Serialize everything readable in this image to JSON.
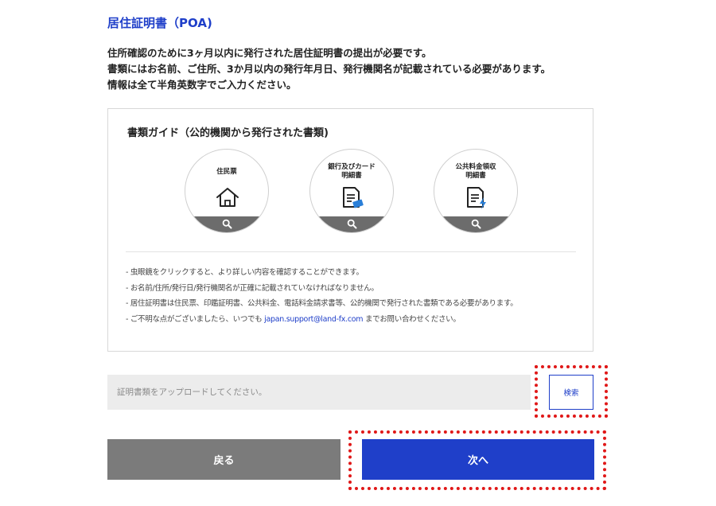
{
  "header": {
    "title": "居住証明書（POA)"
  },
  "description": {
    "lines": [
      "住所確認のために3ヶ月以内に発行された居住証明書の提出が必要です。",
      "書類にはお名前、ご住所、3か月以内の発行年月日、発行機関名が記載されている必要があります。",
      "情報は全て半角英数字でご入力ください。"
    ]
  },
  "guide": {
    "title": "書類ガイド（公的機関から発行された書類)",
    "cards": [
      {
        "label": "住民票",
        "icon": "house-icon"
      },
      {
        "label_line1": "銀行及びカード",
        "label_line2": "明細書",
        "icon": "bank-statement-icon"
      },
      {
        "label_line1": "公共料金領収",
        "label_line2": "明細書",
        "icon": "utility-bill-icon"
      }
    ],
    "notes": {
      "line1": "- 虫眼鏡をクリックすると、より詳しい内容を確認することができます。",
      "line2": "- お名前/住所/発行日/発行機関名が正確に記載されていなければなりません。",
      "line3": "- 居住証明書は住民票、印鑑証明書、公共料金、電話料金請求書等、公的機関で発行された書類である必要があります。",
      "line4_prefix": "- ご不明な点がございましたら、いつでも ",
      "line4_link": "japan.support@land-fx.com",
      "line4_suffix": " までお問い合わせください。"
    }
  },
  "upload": {
    "placeholder": "証明書類をアップロードしてください。",
    "search_label": "検索"
  },
  "buttons": {
    "back_label": "戻る",
    "next_label": "次へ"
  },
  "colors": {
    "accent": "#1f3fc9",
    "back_button": "#7b7b7b",
    "highlight": "#e01818"
  }
}
